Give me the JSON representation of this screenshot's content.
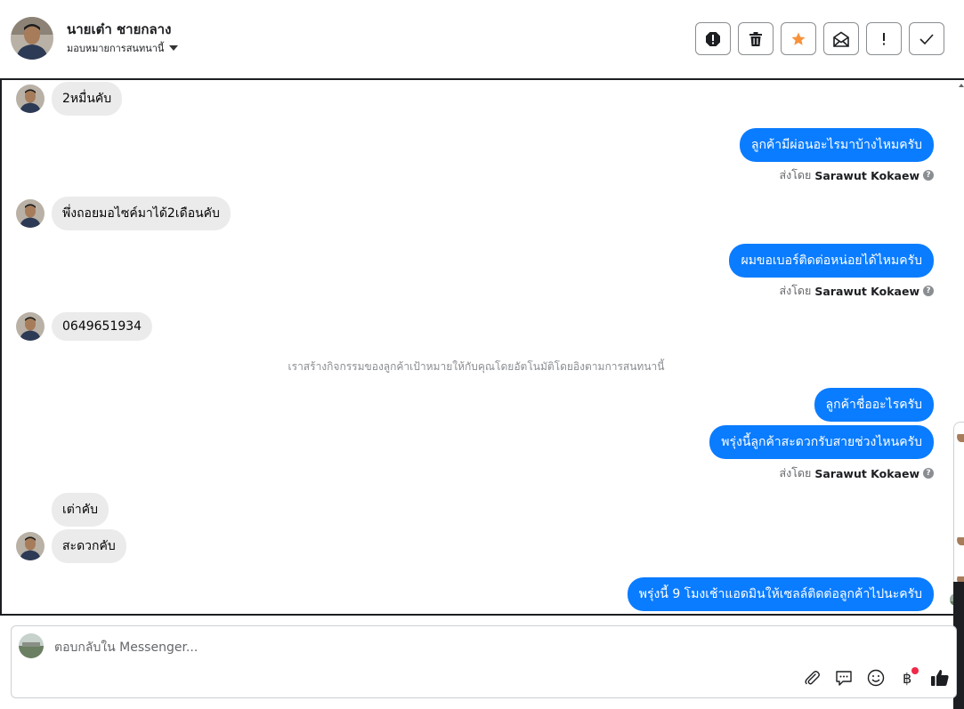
{
  "header": {
    "contact_name": "นายเต๋า ชายกลาง",
    "assign_label": "มอบหมายการสนทนานี้"
  },
  "conversation": {
    "messages": [
      {
        "dir": "in",
        "text": "2หมื่นคับ"
      },
      {
        "dir": "out",
        "text": "ลูกค้ามีผ่อนอะไรมาบ้างไหมครับ"
      },
      {
        "dir": "in",
        "text": "พึ่งถอยมอไซค์มาได้2เดือนคับ"
      },
      {
        "dir": "out",
        "text": "ผมขอเบอร์ติดต่อหน่อยได้ไหมครับ"
      },
      {
        "dir": "in",
        "text": "0649651934"
      },
      {
        "dir": "out",
        "text": "ลูกค้าชื่ออะไรครับ"
      },
      {
        "dir": "out",
        "text": "พรุ่งนี้ลูกค้าสะดวกรับสายช่วงไหนครับ"
      },
      {
        "dir": "in",
        "text": "เต่าคับ"
      },
      {
        "dir": "in",
        "text": "สะดวกคับ"
      },
      {
        "dir": "out",
        "text": "พรุ่งนี้ 9 โมงเช้าแอดมินให้เซลล์ติดต่อลูกค้าไปนะครับ"
      }
    ],
    "sent_by_prefix": "ส่งโดย",
    "sent_by_name": "Sarawut Kokaew",
    "system_note": "เราสร้างกิจกรรมของลูกค้าเป้าหมายให้กับคุณโดยอัตโนมัติโดยอิงตามการสนทนานี้"
  },
  "composer": {
    "placeholder": "ตอบกลับใน Messenger..."
  },
  "colors": {
    "outgoing_bubble": "#0a7cff",
    "incoming_bubble": "#ebebeb",
    "star_icon": "#f7923b",
    "badge_dot": "#f02849"
  }
}
